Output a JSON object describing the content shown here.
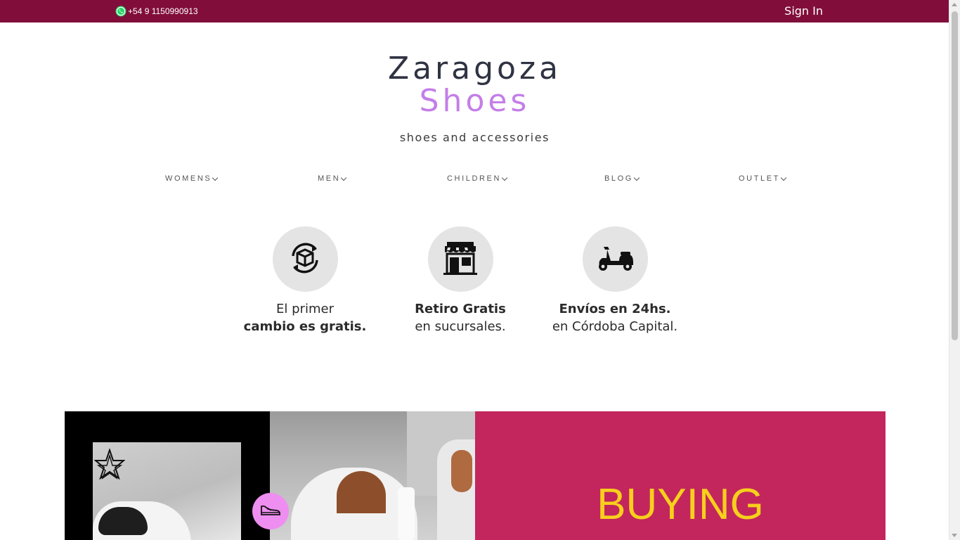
{
  "topbar": {
    "phone": "+54 9 1150990913",
    "phone_icon": "whatsapp-icon",
    "signin_label": "Sign In"
  },
  "logo": {
    "line1": "Zaragoza",
    "line2": "Shoes",
    "tagline": "shoes and accessories"
  },
  "nav": {
    "items": [
      {
        "label": "WOMENS"
      },
      {
        "label": "MEN"
      },
      {
        "label": "CHILDREN"
      },
      {
        "label": "BLOG"
      },
      {
        "label": "OUTLET"
      }
    ]
  },
  "features": [
    {
      "icon": "box-exchange-icon",
      "line1": "El primer",
      "line2": "cambio es gratis."
    },
    {
      "icon": "store-icon",
      "line1": "Retiro Gratis",
      "line2": "en sucursales."
    },
    {
      "icon": "scooter-icon",
      "line1": "Envíos en 24hs.",
      "line2": "en Córdoba Capital."
    }
  ],
  "banner": {
    "promo_text": "BUYING",
    "star_icon": "star-icon",
    "badge_icon": "sneaker-icon"
  },
  "colors": {
    "topbar": "#810e3a",
    "logo_accent": "#c47ee8",
    "promo_bg": "#c2265d",
    "promo_text": "#f7cf1c"
  }
}
